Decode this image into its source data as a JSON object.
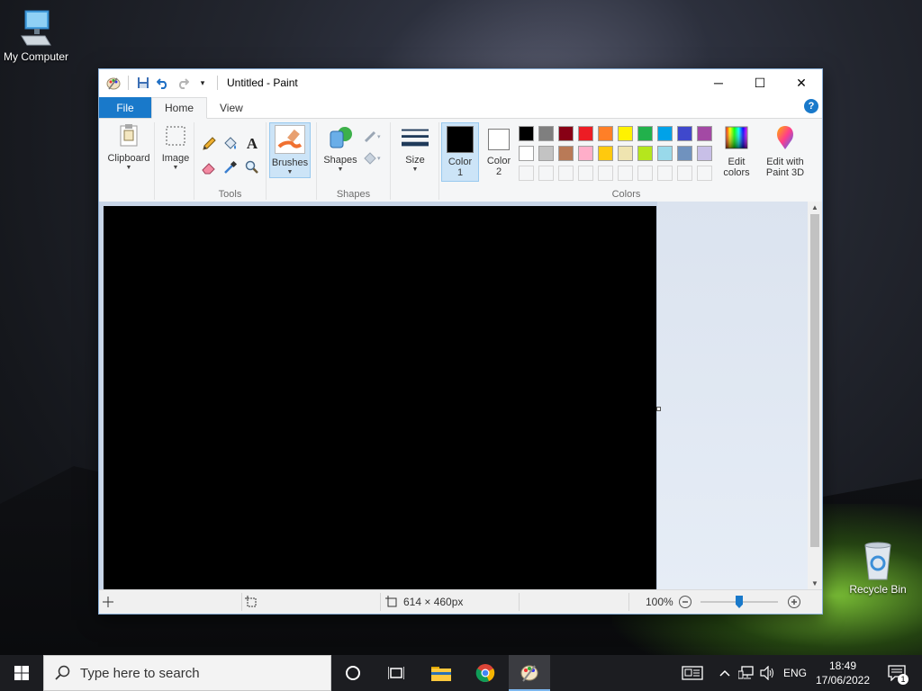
{
  "desktop": {
    "icons": [
      {
        "label": "My Computer"
      },
      {
        "label": "Recycle Bin"
      }
    ]
  },
  "window": {
    "title": "Untitled - Paint",
    "controls": {
      "minimize": "─",
      "maximize": "☐",
      "close": "✕"
    },
    "tabs": [
      {
        "label": "File"
      },
      {
        "label": "Home"
      },
      {
        "label": "View"
      }
    ],
    "help": "?"
  },
  "ribbon": {
    "clipboard": {
      "label": "Clipboard"
    },
    "image": {
      "label": "Image"
    },
    "tools": {
      "label": "Tools"
    },
    "brushes": {
      "label": "Brushes"
    },
    "shapes": {
      "button_label": "Shapes",
      "group_label": "Shapes"
    },
    "size": {
      "label": "Size"
    },
    "color1": {
      "line1": "Color",
      "line2": "1",
      "value": "#000000"
    },
    "color2": {
      "line1": "Color",
      "line2": "2",
      "value": "#ffffff"
    },
    "colors_group_label": "Colors",
    "edit_colors": {
      "line1": "Edit",
      "line2": "colors"
    },
    "paint3d": {
      "line1": "Edit with",
      "line2": "Paint 3D"
    },
    "palette_row1": [
      "#000000",
      "#7f7f7f",
      "#880015",
      "#ed1c24",
      "#ff7f27",
      "#fff200",
      "#22b14c",
      "#00a2e8",
      "#3f48cc",
      "#a349a4"
    ],
    "palette_row2": [
      "#ffffff",
      "#c3c3c3",
      "#b97a57",
      "#ffaec9",
      "#ffc90e",
      "#efe4b0",
      "#b5e61d",
      "#99d9ea",
      "#7092be",
      "#c8bfe7"
    ]
  },
  "status": {
    "dimensions": "614 × 460px",
    "zoom": "100%"
  },
  "taskbar": {
    "search_placeholder": "Type here to search",
    "tray": {
      "language": "ENG",
      "time": "18:49",
      "date": "17/06/2022",
      "notifications": "1"
    }
  }
}
